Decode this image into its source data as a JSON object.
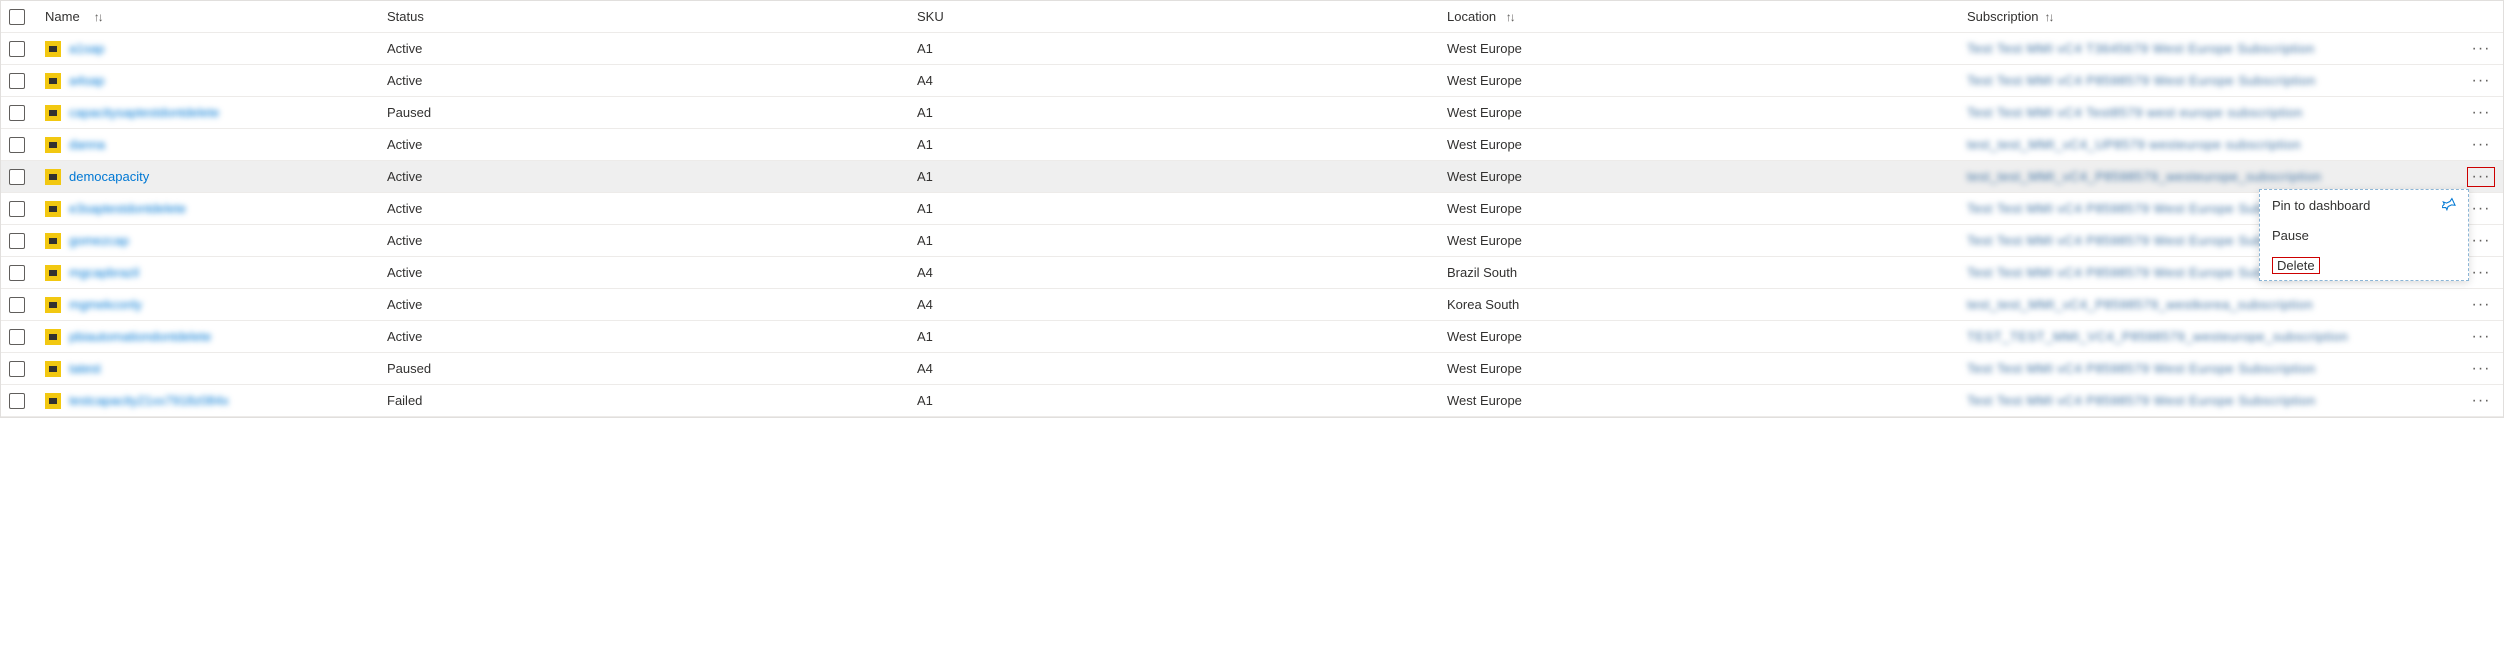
{
  "columns": {
    "name": "Name",
    "status": "Status",
    "sku": "SKU",
    "location": "Location",
    "subscription": "Subscription"
  },
  "rows": [
    {
      "name": "a1sap",
      "status": "Active",
      "sku": "A1",
      "location": "West Europe",
      "subscription": "Test Test MMI vC4 T3645679 West Europe Subscription",
      "blurred": true,
      "highlight": false,
      "actions_highlight": false
    },
    {
      "name": "a4sap",
      "status": "Active",
      "sku": "A4",
      "location": "West Europe",
      "subscription": "Test Test MMI vC4 P8598579 West Europe Subscription",
      "blurred": true,
      "highlight": false,
      "actions_highlight": false
    },
    {
      "name": "capacitysaptestdontdelete",
      "status": "Paused",
      "sku": "A1",
      "location": "West Europe",
      "subscription": "Test Test MMI vC4 Test8579 west europe subscription",
      "blurred": true,
      "highlight": false,
      "actions_highlight": false
    },
    {
      "name": "danna",
      "status": "Active",
      "sku": "A1",
      "location": "West Europe",
      "subscription": "test_test_MMI_vC4_UP8579 westeurope subscription",
      "blurred": true,
      "highlight": false,
      "actions_highlight": false
    },
    {
      "name": "democapacity",
      "status": "Active",
      "sku": "A1",
      "location": "West Europe",
      "subscription": "test_test_MMI_vC4_P8598579_westeurope_subscription",
      "blurred": false,
      "highlight": true,
      "actions_highlight": true
    },
    {
      "name": "e3saptestdontdelete",
      "status": "Active",
      "sku": "A1",
      "location": "West Europe",
      "subscription": "Test Test MMI vC4 P8598579 West Europe Subscription",
      "blurred": true,
      "highlight": false,
      "actions_highlight": false
    },
    {
      "name": "gomezcap",
      "status": "Active",
      "sku": "A1",
      "location": "West Europe",
      "subscription": "Test Test MMI vC4 P8598579 West Europe Subscription",
      "blurred": true,
      "highlight": false,
      "actions_highlight": false
    },
    {
      "name": "mgcapbrazil",
      "status": "Active",
      "sku": "A4",
      "location": "Brazil South",
      "subscription": "Test Test MMI vC4 P8598579 West Europe Subscription",
      "blurred": true,
      "highlight": false,
      "actions_highlight": false
    },
    {
      "name": "mgmekconly",
      "status": "Active",
      "sku": "A4",
      "location": "Korea South",
      "subscription": "test_test_MMI_vC4_P8598579_westkorea_subscription",
      "blurred": true,
      "highlight": false,
      "actions_highlight": false
    },
    {
      "name": "pbiautomationdontdelete",
      "status": "Active",
      "sku": "A1",
      "location": "West Europe",
      "subscription": "TEST_TEST_MMI_VC4_P8598579_westeurope_subscription",
      "blurred": true,
      "highlight": false,
      "actions_highlight": false
    },
    {
      "name": "tatest",
      "status": "Paused",
      "sku": "A4",
      "location": "West Europe",
      "subscription": "Test Test MMI vC4 P8598579 West Europe Subscription",
      "blurred": true,
      "highlight": false,
      "actions_highlight": false
    },
    {
      "name": "testcapacity21xx7918z084x",
      "status": "Failed",
      "sku": "A1",
      "location": "West Europe",
      "subscription": "Test Test MMI vC4 P8598579 West Europe Subscription",
      "blurred": true,
      "highlight": false,
      "actions_highlight": false
    }
  ],
  "context_menu": {
    "visible_on_row": 4,
    "items": {
      "pin": "Pin to dashboard",
      "pause": "Pause",
      "delete": "Delete"
    }
  }
}
